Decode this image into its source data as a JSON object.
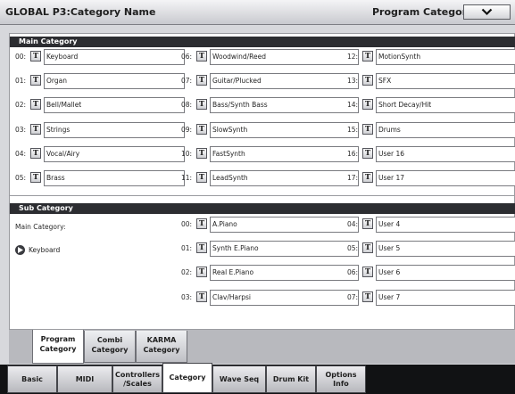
{
  "header": {
    "title": "GLOBAL P3:Category Name",
    "page_menu_label": "Program Category"
  },
  "main_category": {
    "section_title": "Main Category",
    "t_icon_text": "T",
    "items": [
      {
        "index": "00:",
        "name": "Keyboard"
      },
      {
        "index": "01:",
        "name": "Organ"
      },
      {
        "index": "02:",
        "name": "Bell/Mallet"
      },
      {
        "index": "03:",
        "name": "Strings"
      },
      {
        "index": "04:",
        "name": "Vocal/Airy"
      },
      {
        "index": "05:",
        "name": "Brass"
      },
      {
        "index": "06:",
        "name": "Woodwind/Reed"
      },
      {
        "index": "07:",
        "name": "Guitar/Plucked"
      },
      {
        "index": "08:",
        "name": "Bass/Synth Bass"
      },
      {
        "index": "09:",
        "name": "SlowSynth"
      },
      {
        "index": "10:",
        "name": "FastSynth"
      },
      {
        "index": "11:",
        "name": "LeadSynth"
      },
      {
        "index": "12:",
        "name": "MotionSynth"
      },
      {
        "index": "13:",
        "name": "SFX"
      },
      {
        "index": "14:",
        "name": "Short Decay/Hit"
      },
      {
        "index": "15:",
        "name": "Drums"
      },
      {
        "index": "16:",
        "name": "User 16"
      },
      {
        "index": "17:",
        "name": "User 17"
      }
    ]
  },
  "sub_category": {
    "section_title": "Sub Category",
    "main_category_label": "Main Category:",
    "selected_main_category": "Keyboard",
    "items": [
      {
        "index": "00:",
        "name": "A.Piano"
      },
      {
        "index": "01:",
        "name": "Synth E.Piano"
      },
      {
        "index": "02:",
        "name": "Real E.Piano"
      },
      {
        "index": "03:",
        "name": "Clav/Harpsi"
      },
      {
        "index": "04:",
        "name": "User 4"
      },
      {
        "index": "05:",
        "name": "User 5"
      },
      {
        "index": "06:",
        "name": "User 6"
      },
      {
        "index": "07:",
        "name": "User 7"
      }
    ]
  },
  "page_tabs": [
    {
      "label": "Program\nCategory",
      "active": true
    },
    {
      "label": "Combi\nCategory",
      "active": false
    },
    {
      "label": "KARMA\nCategory",
      "active": false
    }
  ],
  "mode_tabs": [
    {
      "label": "Basic",
      "active": false
    },
    {
      "label": "MIDI",
      "active": false
    },
    {
      "label": "Controllers\n/Scales",
      "active": false
    },
    {
      "label": "Category",
      "active": true
    },
    {
      "label": "Wave Seq",
      "active": false
    },
    {
      "label": "Drum Kit",
      "active": false
    },
    {
      "label": "Options\nInfo",
      "active": false
    }
  ],
  "colors": {
    "section_header_bg": "#2c2d31",
    "tab_bar_bg": "#111214",
    "panel_bg": "#ffffff"
  }
}
